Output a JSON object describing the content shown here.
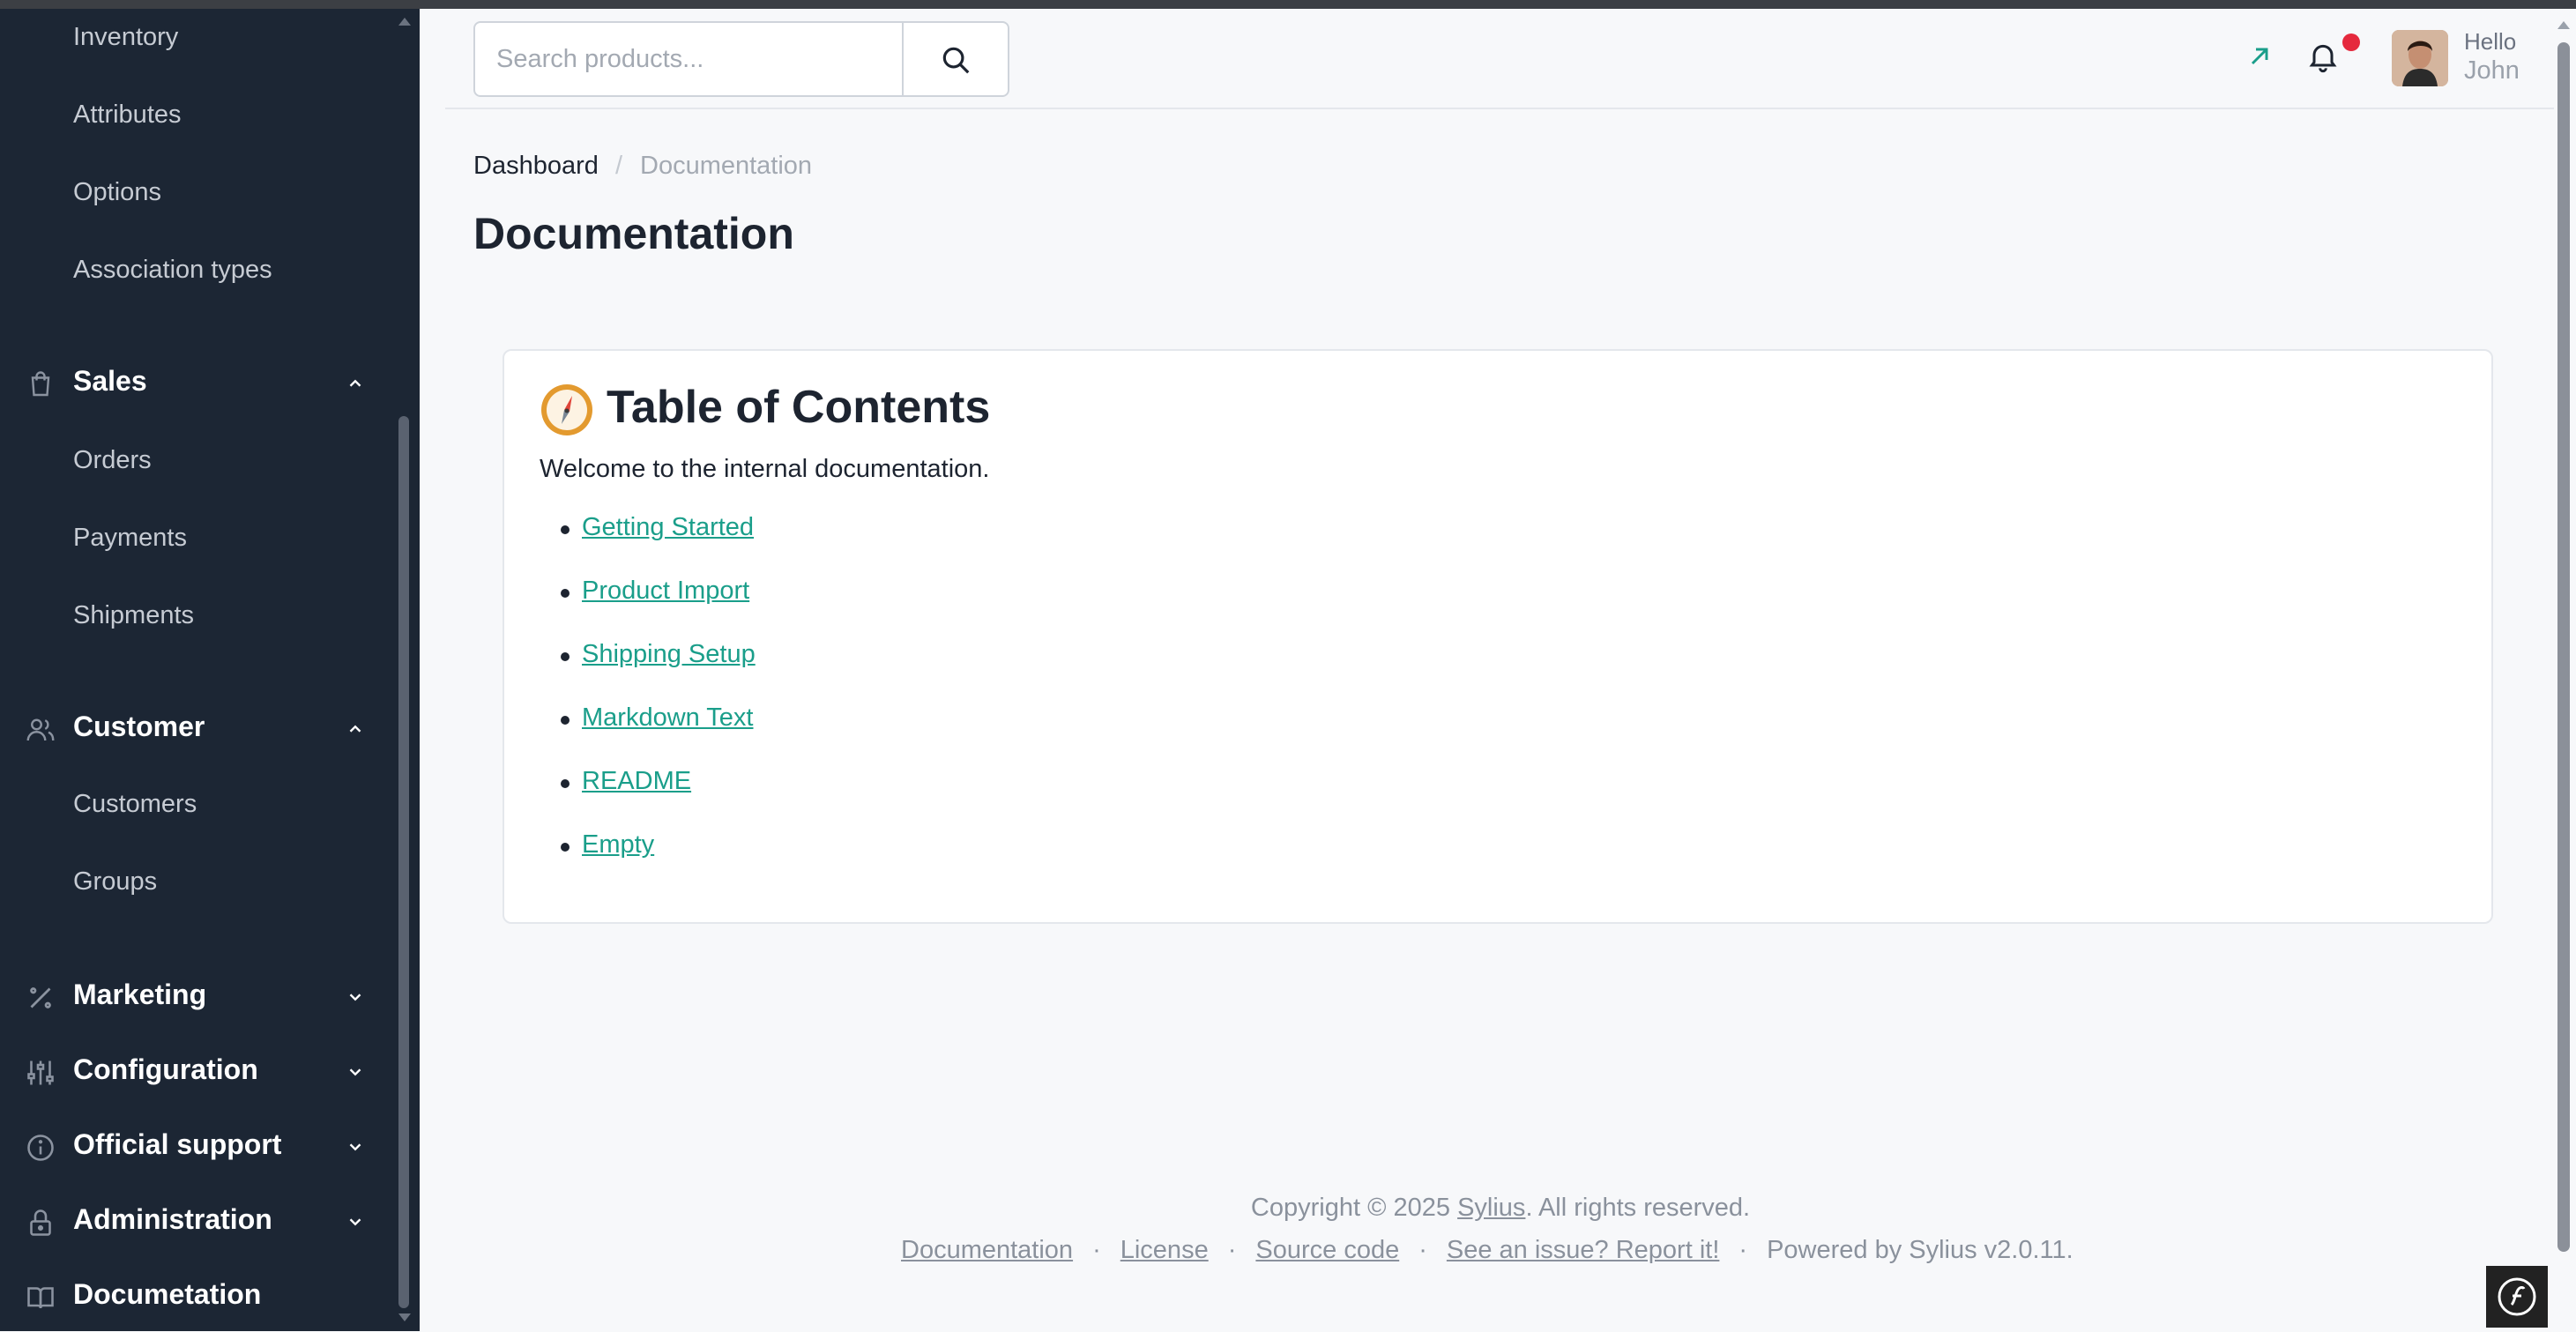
{
  "sidebar": {
    "product_subitems": [
      "Inventory",
      "Attributes",
      "Options",
      "Association types"
    ],
    "sales": {
      "label": "Sales",
      "items": [
        "Orders",
        "Payments",
        "Shipments"
      ]
    },
    "customer": {
      "label": "Customer",
      "items": [
        "Customers",
        "Groups"
      ]
    },
    "sections": [
      {
        "label": "Marketing",
        "icon": "percent-icon"
      },
      {
        "label": "Configuration",
        "icon": "sliders-icon"
      },
      {
        "label": "Official support",
        "icon": "info-icon"
      },
      {
        "label": "Administration",
        "icon": "lock-icon"
      },
      {
        "label": "Documetation",
        "icon": "book-icon"
      }
    ]
  },
  "header": {
    "search_placeholder": "Search products...",
    "hello": "Hello",
    "username": "John"
  },
  "breadcrumb": {
    "home": "Dashboard",
    "separator": "/",
    "current": "Documentation"
  },
  "page_title": "Documentation",
  "card": {
    "title": "Table of Contents",
    "intro": "Welcome to the internal documentation.",
    "links": [
      "Getting Started",
      "Product Import",
      "Shipping Setup",
      "Markdown Text",
      "README",
      "Empty"
    ]
  },
  "footer": {
    "copyright_prefix": "Copyright © 2025",
    "brand_link": "Sylius",
    "copyright_suffix": ". All rights reserved.",
    "links": [
      "Documentation",
      "License",
      "Source code",
      "See an issue? Report it!"
    ],
    "powered_by": "Powered by Sylius v2.0.11.",
    "separator": "·"
  },
  "colors": {
    "sidebar_bg": "#1c2634",
    "accent": "#1a9e8a",
    "notification_dot": "#e5293d"
  }
}
